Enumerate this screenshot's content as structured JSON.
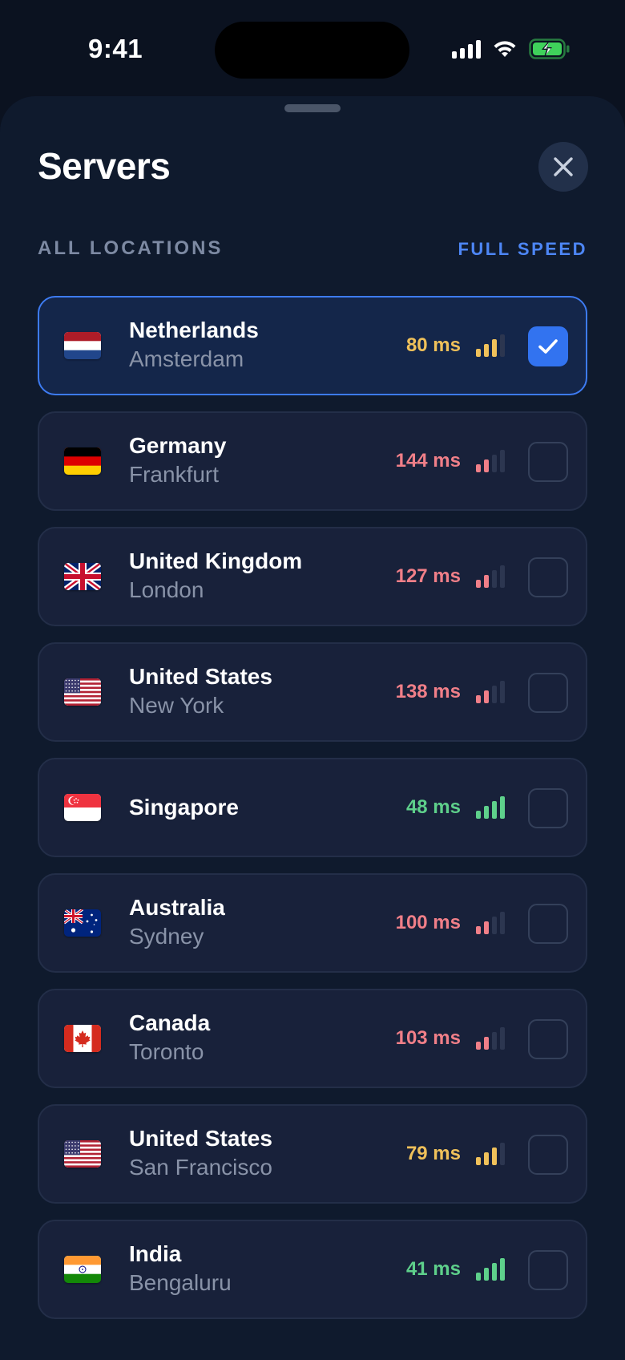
{
  "status_bar": {
    "time": "9:41",
    "icons": [
      "cellular-signal-icon",
      "wifi-icon",
      "battery-charging-icon"
    ]
  },
  "sheet": {
    "title": "Servers",
    "close_icon": "close-icon",
    "section_label": "ALL LOCATIONS",
    "section_action": "FULL SPEED"
  },
  "colors": {
    "accent": "#3273f0",
    "latency_good": "#5ed08b",
    "latency_ok": "#f0c15a",
    "latency_bad": "#f07f88"
  },
  "servers": [
    {
      "flag": "netherlands-flag-icon",
      "country": "Netherlands",
      "city": "Amsterdam",
      "latency": "80 ms",
      "quality": "ok",
      "signal_bars": 3,
      "selected": true
    },
    {
      "flag": "germany-flag-icon",
      "country": "Germany",
      "city": "Frankfurt",
      "latency": "144 ms",
      "quality": "bad",
      "signal_bars": 2,
      "selected": false
    },
    {
      "flag": "uk-flag-icon",
      "country": "United Kingdom",
      "city": "London",
      "latency": "127 ms",
      "quality": "bad",
      "signal_bars": 2,
      "selected": false
    },
    {
      "flag": "us-flag-icon",
      "country": "United States",
      "city": "New York",
      "latency": "138 ms",
      "quality": "bad",
      "signal_bars": 2,
      "selected": false
    },
    {
      "flag": "singapore-flag-icon",
      "country": "Singapore",
      "city": "",
      "latency": "48 ms",
      "quality": "good",
      "signal_bars": 4,
      "selected": false
    },
    {
      "flag": "australia-flag-icon",
      "country": "Australia",
      "city": "Sydney",
      "latency": "100 ms",
      "quality": "bad",
      "signal_bars": 2,
      "selected": false
    },
    {
      "flag": "canada-flag-icon",
      "country": "Canada",
      "city": "Toronto",
      "latency": "103 ms",
      "quality": "bad",
      "signal_bars": 2,
      "selected": false
    },
    {
      "flag": "us-flag-icon",
      "country": "United States",
      "city": "San Francisco",
      "latency": "79 ms",
      "quality": "ok",
      "signal_bars": 3,
      "selected": false
    },
    {
      "flag": "india-flag-icon",
      "country": "India",
      "city": "Bengaluru",
      "latency": "41 ms",
      "quality": "good",
      "signal_bars": 4,
      "selected": false
    }
  ]
}
